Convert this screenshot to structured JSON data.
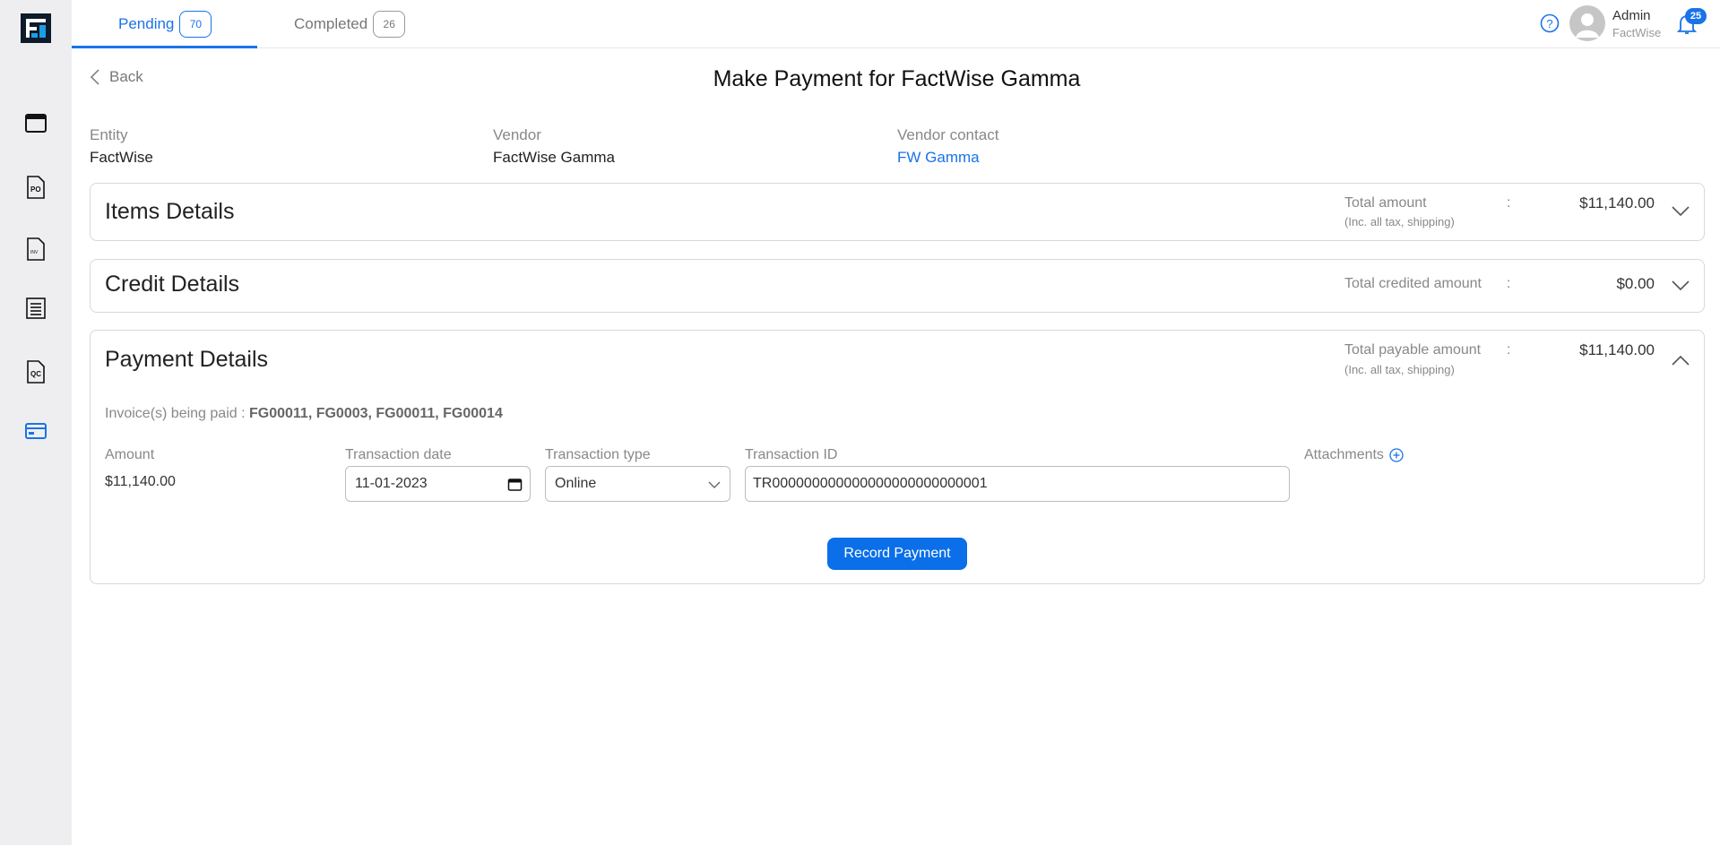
{
  "tabs": [
    {
      "label": "Pending",
      "count": "70"
    },
    {
      "label": "Completed",
      "count": "26"
    }
  ],
  "user": {
    "name": "Admin",
    "org": "FactWise"
  },
  "notifications": {
    "count": "25"
  },
  "header": {
    "back_label": "Back",
    "title": "Make Payment for FactWise Gamma"
  },
  "info": {
    "entity_label": "Entity",
    "entity_value": "FactWise",
    "vendor_label": "Vendor",
    "vendor_value": "FactWise Gamma",
    "contact_label": "Vendor contact",
    "contact_value": "FW Gamma"
  },
  "items_card": {
    "title": "Items Details",
    "summary_label": "Total amount",
    "summary_sub": "(Inc. all tax, shipping)",
    "colon": ":",
    "summary_value": "$11,140.00"
  },
  "credit_card": {
    "title": "Credit Details",
    "summary_label": "Total credited amount",
    "colon": ":",
    "summary_value": "$0.00"
  },
  "payment_card": {
    "title": "Payment Details",
    "summary_label": "Total payable amount",
    "summary_sub": "(Inc. all tax, shipping)",
    "colon": ":",
    "summary_value": "$11,140.00",
    "invoices_label": "Invoice(s) being paid :",
    "invoices_value": "FG00011, FG0003, FG00011, FG00014",
    "amount_label": "Amount",
    "amount_value": "$11,140.00",
    "date_label": "Transaction date",
    "date_value": "11-01-2023",
    "type_label": "Transaction type",
    "type_value": "Online",
    "id_label": "Transaction ID",
    "id_value": "TR000000000000000000000000001",
    "attachments_label": "Attachments",
    "record_button": "Record Payment"
  },
  "colors": {
    "accent": "#1a73e8",
    "button": "#0a6fe8",
    "sidebar": "#eeeef0"
  },
  "icons": [
    "logo",
    "calendar-icon",
    "po-document-icon",
    "invoice-document-icon",
    "list-document-icon",
    "qc-document-icon",
    "payment-card-icon",
    "help-icon",
    "avatar-icon",
    "bell-icon",
    "chevron-left-icon",
    "chevron-down-icon",
    "chevron-up-icon",
    "info-plus-icon"
  ]
}
